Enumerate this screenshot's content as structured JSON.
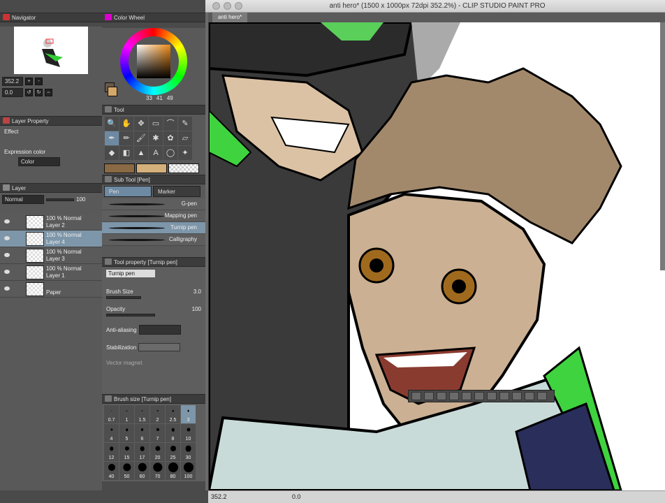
{
  "window": {
    "title": "anti hero* (1500 x 1000px 72dpi 352.2%) - CLIP STUDIO PAINT PRO"
  },
  "document_tab": "anti hero*",
  "navigator": {
    "title": "Navigator",
    "zoom": "352.2",
    "angle": "0.0"
  },
  "color_wheel": {
    "title": "Color Wheel",
    "values": [
      "33",
      "41",
      "49"
    ],
    "main_color": "#d4a86a",
    "sub_color": "#6a5a48"
  },
  "layer_property": {
    "title": "Layer Property",
    "effect_label": "Effect",
    "expression_label": "Expression color",
    "expression_value": "Color"
  },
  "tool_panel": {
    "title": "Tool",
    "color_swatches": [
      "#8a6a44",
      "#d4b07a"
    ]
  },
  "layer_panel": {
    "title": "Layer",
    "blend_mode": "Normal",
    "opacity": "100",
    "layers": [
      {
        "line1": "100 % Normal",
        "line2": "Layer 2",
        "selected": false
      },
      {
        "line1": "100 % Normal",
        "line2": "Layer 4",
        "selected": true
      },
      {
        "line1": "100 % Normal",
        "line2": "Layer 3",
        "selected": false
      },
      {
        "line1": "100 % Normal",
        "line2": "Layer 1",
        "selected": false
      },
      {
        "line1": "",
        "line2": "Paper",
        "selected": false
      }
    ]
  },
  "sub_tool": {
    "title": "Sub Tool [Pen]",
    "tab_pen": "Pen",
    "tab_marker": "Marker",
    "pens": [
      {
        "name": "G-pen",
        "selected": false
      },
      {
        "name": "Mapping pen",
        "selected": false
      },
      {
        "name": "Turnip pen",
        "selected": true
      },
      {
        "name": "Calligraphy",
        "selected": false
      }
    ]
  },
  "tool_property": {
    "title": "Tool property [Turnip pen]",
    "preset": "Turnip pen",
    "brush_size_label": "Brush Size",
    "brush_size_value": "3.0",
    "opacity_label": "Opacity",
    "opacity_value": "100",
    "antialias_label": "Anti-aliasing",
    "stabilization_label": "Stabilization",
    "vector_magnet_label": "Vector magnet"
  },
  "brush_size": {
    "title": "Brush size [Turnip pen]",
    "sizes": [
      "0.7",
      "1",
      "1.5",
      "2",
      "2.5",
      "3",
      "4",
      "5",
      "6",
      "7",
      "8",
      "10",
      "12",
      "15",
      "17",
      "20",
      "25",
      "30",
      "40",
      "50",
      "60",
      "70",
      "80",
      "100"
    ],
    "selected": "3"
  },
  "status": {
    "zoom": "352.2",
    "angle": "0.0"
  }
}
